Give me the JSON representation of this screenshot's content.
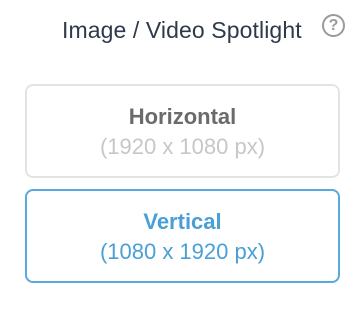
{
  "header": {
    "title": "Image / Video Spotlight",
    "help_icon": "question-circle-icon",
    "help_glyph": "?"
  },
  "options": [
    {
      "label": "Horizontal",
      "dimensions": "(1920 x 1080 px)",
      "selected": false
    },
    {
      "label": "Vertical",
      "dimensions": "(1080 x 1920 px)",
      "selected": true
    }
  ],
  "colors": {
    "title": "#2e3a4b",
    "accent": "#4a9fd6",
    "selected_border": "#5aa9dc",
    "unselected_border": "#e3e3e3",
    "unselected_label": "#6b6b6b",
    "unselected_dims": "#c7c7c7",
    "icon": "#9a9a9a"
  }
}
